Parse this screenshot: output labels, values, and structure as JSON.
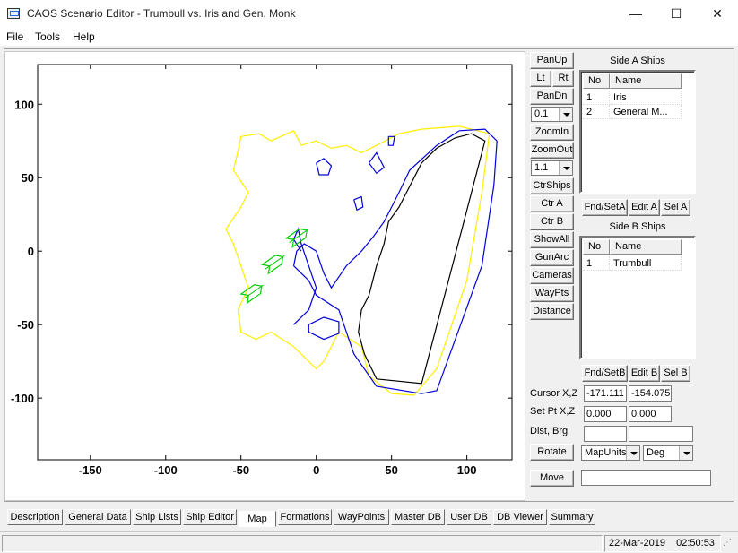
{
  "window": {
    "title": "CAOS Scenario Editor - Trumbull vs. Iris and Gen. Monk",
    "minimize": "—",
    "maximize": "☐",
    "close": "✕"
  },
  "menu": [
    "File",
    "Tools",
    "Help"
  ],
  "map_controls": {
    "pan_up": "PanUp",
    "left": "Lt",
    "right": "Rt",
    "pan_down": "PanDn",
    "pan_step": "0.1",
    "zoom_in": "ZoomIn",
    "zoom_out": "ZoomOut",
    "zoom_factor": "1.1",
    "ctr_ships": "CtrShips",
    "ctr_a": "Ctr A",
    "ctr_b": "Ctr B",
    "show_all": "ShowAll",
    "gun_arc": "GunArc",
    "cameras": "Cameras",
    "way_pts": "WayPts",
    "distance": "Distance",
    "rotate": "Rotate",
    "move": "Move"
  },
  "readouts": {
    "cursor_label": "Cursor X,Z",
    "cursor_x": "-171.111",
    "cursor_z": "-154.075",
    "setpt_label": "Set Pt X,Z",
    "setpt_x": "0.000",
    "setpt_z": "0.000",
    "dist_label": "Dist, Brg",
    "dist": "",
    "brg": "",
    "units": "MapUnits",
    "angle_units": "Deg",
    "message": ""
  },
  "side_a": {
    "title": "Side A Ships",
    "columns": [
      "No",
      "Name"
    ],
    "rows": [
      [
        "1",
        "Iris"
      ],
      [
        "2",
        "General M..."
      ]
    ],
    "find_set": "Fnd/SetA",
    "edit": "Edit A",
    "select": "Sel A"
  },
  "side_b": {
    "title": "Side B Ships",
    "columns": [
      "No",
      "Name"
    ],
    "rows": [
      [
        "1",
        "Trumbull"
      ]
    ],
    "find_set": "Fnd/SetB",
    "edit": "Edit B",
    "select": "Sel B"
  },
  "tabs": [
    "Description",
    "General Data",
    "Ship Lists",
    "Ship Editor",
    "Map",
    "Formations",
    "WayPoints",
    "Master DB",
    "User DB",
    "DB Viewer",
    "Summary"
  ],
  "active_tab": "Map",
  "status": {
    "date": "22-Mar-2019",
    "time": "02:50:53"
  },
  "colors": {
    "coastline_outer": "#ffee00",
    "coastline_blue": "#0000dd",
    "coastline_black": "#000000",
    "ships_green": "#00cc00"
  },
  "chart_data": {
    "type": "map",
    "x_ticks": [
      "-150",
      "-100",
      "-50",
      "0",
      "50",
      "100"
    ],
    "y_ticks": [
      "100",
      "50",
      "0",
      "-50",
      "-100"
    ],
    "xlim": [
      -185,
      130
    ],
    "ylim": [
      -142,
      127
    ],
    "yellow_outline": [
      [
        -50,
        78
      ],
      [
        -38,
        80
      ],
      [
        -30,
        75
      ],
      [
        -15,
        82
      ],
      [
        -10,
        72
      ],
      [
        0,
        75
      ],
      [
        10,
        70
      ],
      [
        20,
        72
      ],
      [
        30,
        67
      ],
      [
        40,
        72
      ],
      [
        55,
        80
      ],
      [
        70,
        83
      ],
      [
        95,
        85
      ],
      [
        115,
        80
      ],
      [
        110,
        40
      ],
      [
        100,
        -20
      ],
      [
        80,
        -80
      ],
      [
        65,
        -98
      ],
      [
        50,
        -97
      ],
      [
        35,
        -85
      ],
      [
        30,
        -65
      ],
      [
        15,
        -55
      ],
      [
        5,
        -75
      ],
      [
        0,
        -80
      ],
      [
        -15,
        -65
      ],
      [
        -30,
        -55
      ],
      [
        -40,
        -60
      ],
      [
        -50,
        -55
      ],
      [
        -52,
        -40
      ],
      [
        -45,
        -25
      ],
      [
        -50,
        -10
      ],
      [
        -55,
        5
      ],
      [
        -60,
        15
      ],
      [
        -50,
        30
      ],
      [
        -45,
        40
      ],
      [
        -55,
        55
      ],
      [
        -52,
        68
      ],
      [
        -50,
        78
      ]
    ],
    "blue_coast": [
      [
        -15,
        -10
      ],
      [
        -5,
        -20
      ],
      [
        0,
        -30
      ],
      [
        15,
        -40
      ],
      [
        20,
        -55
      ],
      [
        25,
        -70
      ],
      [
        40,
        -92
      ],
      [
        70,
        -97
      ],
      [
        80,
        -95
      ],
      [
        110,
        -10
      ],
      [
        118,
        45
      ],
      [
        120,
        75
      ],
      [
        112,
        83
      ],
      [
        95,
        82
      ],
      [
        80,
        72
      ],
      [
        62,
        55
      ],
      [
        55,
        40
      ],
      [
        50,
        30
      ],
      [
        45,
        20
      ],
      [
        38,
        10
      ],
      [
        30,
        0
      ],
      [
        20,
        -10
      ],
      [
        10,
        -25
      ],
      [
        5,
        -15
      ],
      [
        0,
        0
      ],
      [
        -8,
        5
      ],
      [
        -13,
        0
      ],
      [
        -15,
        -10
      ]
    ],
    "blue_channel": [
      [
        -15,
        -50
      ],
      [
        -5,
        -40
      ],
      [
        0,
        -25
      ],
      [
        -5,
        -10
      ],
      [
        -10,
        5
      ],
      [
        -12,
        15
      ],
      [
        -15,
        8
      ],
      [
        -10,
        0
      ]
    ],
    "blue_islands": [
      [
        [
          0,
          60
        ],
        [
          5,
          63
        ],
        [
          10,
          58
        ],
        [
          8,
          52
        ],
        [
          2,
          52
        ],
        [
          0,
          60
        ]
      ],
      [
        [
          25,
          35
        ],
        [
          30,
          37
        ],
        [
          31,
          30
        ],
        [
          27,
          28
        ],
        [
          25,
          35
        ]
      ],
      [
        [
          -5,
          -50
        ],
        [
          5,
          -45
        ],
        [
          15,
          -48
        ],
        [
          15,
          -56
        ],
        [
          5,
          -60
        ],
        [
          -5,
          -55
        ],
        [
          -5,
          -50
        ]
      ],
      [
        [
          48,
          78
        ],
        [
          52,
          78
        ],
        [
          51,
          72
        ],
        [
          48,
          72
        ],
        [
          48,
          78
        ]
      ],
      [
        [
          35,
          60
        ],
        [
          40,
          67
        ],
        [
          45,
          57
        ],
        [
          40,
          53
        ],
        [
          35,
          60
        ]
      ]
    ],
    "black_coast": [
      [
        40,
        -87
      ],
      [
        70,
        -90
      ],
      [
        112,
        75
      ],
      [
        103,
        80
      ],
      [
        92,
        77
      ],
      [
        80,
        70
      ],
      [
        70,
        60
      ],
      [
        65,
        50
      ],
      [
        60,
        40
      ],
      [
        55,
        30
      ],
      [
        48,
        20
      ],
      [
        45,
        5
      ],
      [
        40,
        -10
      ],
      [
        35,
        -30
      ],
      [
        30,
        -40
      ],
      [
        28,
        -55
      ],
      [
        32,
        -70
      ],
      [
        40,
        -87
      ]
    ],
    "ship_markers": [
      {
        "name": "ship-1",
        "x": -42,
        "y": -28
      },
      {
        "name": "ship-2",
        "x": -28,
        "y": -8
      },
      {
        "name": "ship-3",
        "x": -12,
        "y": 10
      }
    ]
  }
}
